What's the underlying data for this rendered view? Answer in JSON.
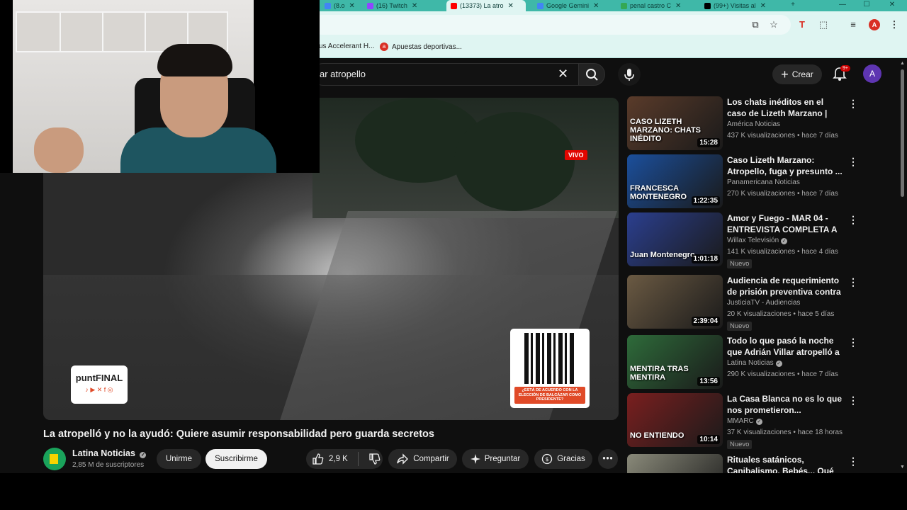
{
  "browser": {
    "tabs": [
      {
        "label": "(8.o",
        "color": "#4285f4"
      },
      {
        "label": "(16) Twitch",
        "color": "#9146ff"
      },
      {
        "label": "(13373) La atro",
        "color": "#ff0000"
      },
      {
        "label": "Google Gemini",
        "color": "#4285f4"
      },
      {
        "label": "penal castro C",
        "color": "#34a853"
      },
      {
        "label": "(99+) Visitas al",
        "color": "#000000"
      }
    ],
    "bookmarks": [
      {
        "label": "us Accelerant H..."
      },
      {
        "label": "Apuestas deportivas..."
      }
    ],
    "window_controls": {
      "minimize": "—",
      "maximize": "☐",
      "close": "✕"
    }
  },
  "youtube": {
    "search_value": "ar atropello",
    "create_label": "Crear",
    "notifications_badge": "9+",
    "avatar_letter": "A",
    "accent": "#ff0000"
  },
  "video": {
    "live_badge": "VIVO",
    "overlay_brand": "puntFINAL",
    "overlay_social": "♪ ▶ ✕ f ◎",
    "qr_caption": "¿ESTÁ DE ACUERDO CON LA ELECCIÓN DE BALCÁZAR COMO PRESIDENTE?",
    "title": "La atropelló y no la ayudó: Quiere asumir responsabilidad pero guarda secretos",
    "channel_name": "Latina Noticias",
    "subscribers": "2,85 M de suscriptores",
    "join_label": "Unirme",
    "subscribe_label": "Suscribirme",
    "likes": "2,9 K",
    "share_label": "Compartir",
    "ask_label": "Preguntar",
    "thanks_label": "Gracias"
  },
  "recommendations": [
    {
      "title": "Los chats inéditos en el caso de Lizeth Marzano | Cuarto Poder...",
      "channel": "América Noticias",
      "verified": false,
      "stats": "437 K visualizaciones • hace 7 días",
      "duration": "15:28",
      "badge": "",
      "thumb_text": "CASO LIZETH MARZANO: CHATS INÉDITO",
      "thumb_color": "#5a3b2a"
    },
    {
      "title": "Caso Lizeth Marzano: Atropello, fuga y presunto ...",
      "channel": "Panamericana Noticias",
      "verified": false,
      "stats": "270 K visualizaciones • hace 7 días",
      "duration": "1:22:35",
      "badge": "",
      "thumb_text": "FRANCESCA MONTENEGRO",
      "thumb_color": "#1b4f9c"
    },
    {
      "title": "Amor y Fuego - MAR 04 - ENTREVISTA COMPLETA A ...",
      "channel": "Willax Televisión",
      "verified": true,
      "stats": "141 K visualizaciones • hace 4 días",
      "duration": "1:01:18",
      "badge": "Nuevo",
      "thumb_text": "Juan Montenegro",
      "thumb_color": "#2b3f8f"
    },
    {
      "title": "Audiencia de requerimiento de prisión preventiva contra ...",
      "channel": "JusticiaTV - Audiencias",
      "verified": false,
      "stats": "20 K visualizaciones • hace 5 días",
      "duration": "2:39:04",
      "badge": "Nuevo",
      "thumb_text": "",
      "thumb_color": "#6b5a43"
    },
    {
      "title": "Todo lo que pasó la noche que Adrián Villar atropelló a Lizet...",
      "channel": "Latina Noticias",
      "verified": true,
      "stats": "290 K visualizaciones • hace 7 días",
      "duration": "13:56",
      "badge": "",
      "thumb_text": "MENTIRA TRAS MENTIRA",
      "thumb_color": "#2e6b3a"
    },
    {
      "title": "La Casa Blanca no es lo que nos prometieron...",
      "channel": "MMARC",
      "verified": true,
      "stats": "37 K visualizaciones • hace 18 horas",
      "duration": "10:14",
      "badge": "Nuevo",
      "thumb_text": "NO ENTIENDO",
      "thumb_color": "#7a1f1f"
    },
    {
      "title": "Rituales satánicos, Canibalismo, Bebés... Qué",
      "channel": "",
      "verified": false,
      "stats": "",
      "duration": "",
      "badge": "",
      "thumb_text": "",
      "thumb_color": "#8a8a7a"
    }
  ]
}
